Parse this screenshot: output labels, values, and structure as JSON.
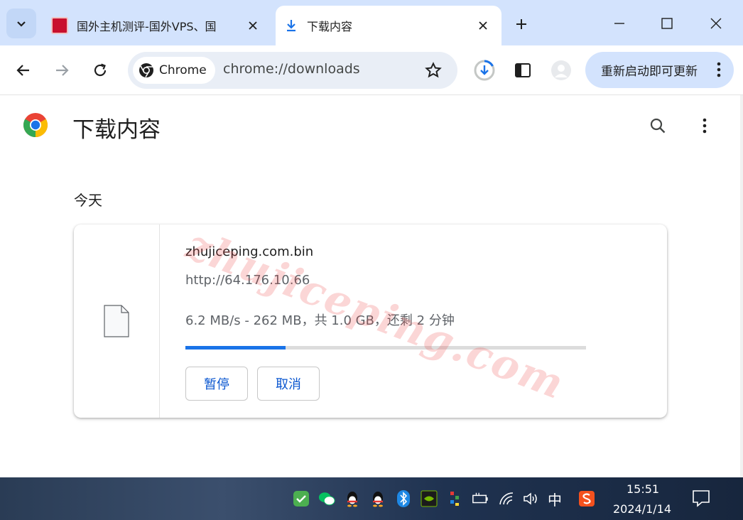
{
  "tabs": [
    {
      "title": "国外主机测评-国外VPS、国"
    },
    {
      "title": "下载内容"
    }
  ],
  "toolbar": {
    "chip_label": "Chrome",
    "url": "chrome://downloads",
    "update_label": "重新启动即可更新"
  },
  "page": {
    "title": "下载内容",
    "day_label": "今天",
    "watermark": "zhujiceping.com"
  },
  "download": {
    "file_name": "zhujiceping.com.bin",
    "source_url": "http://64.176.10.66",
    "status": "6.2 MB/s - 262 MB，共 1.0 GB，还剩 2 分钟",
    "progress_fraction": 0.25,
    "pause_label": "暂停",
    "cancel_label": "取消"
  },
  "taskbar": {
    "ime": "中",
    "time": "15:51",
    "date": "2024/1/14"
  },
  "colors": {
    "accent": "#1a73e8",
    "tabstrip": "#d3e3fd",
    "button_text": "#0b57d0"
  }
}
